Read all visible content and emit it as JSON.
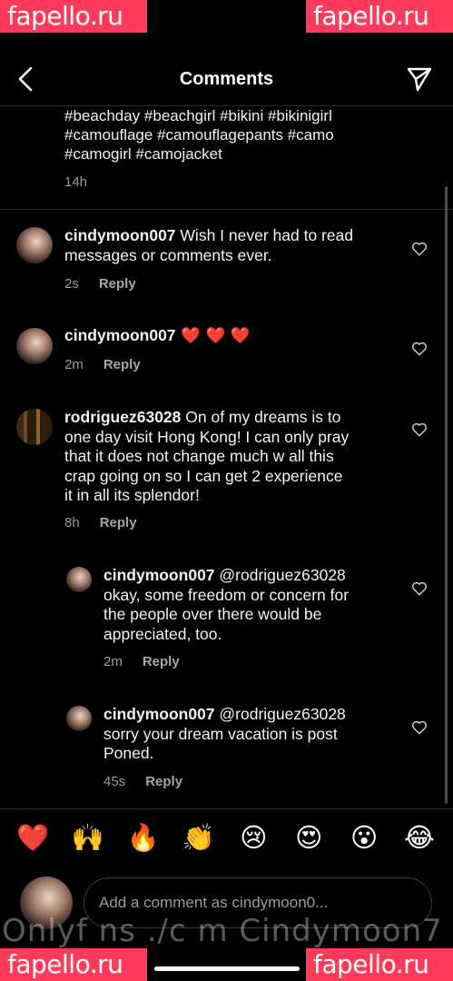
{
  "watermarks": {
    "top_left": "fapello.ru",
    "top_right": "fapello.ru",
    "bottom_left": "fapello.ru",
    "bottom_right": "fapello.ru",
    "overlay_text": "Onlyf ns ./c m Cindymoon7"
  },
  "header": {
    "title": "Comments",
    "back_icon": "chevron-left-icon",
    "send_icon": "paper-plane-icon"
  },
  "caption": {
    "lines": [
      "#beachday #beachgirl #bikini #bikinigirl",
      "#camouflage #camouflagepants #camo",
      "#camogirl #camojacket"
    ],
    "time": "14h"
  },
  "comments": [
    {
      "user": "cindymoon007",
      "lines": [
        "Wish I never had to read",
        "messages or comments ever."
      ],
      "first_line_rest": " Wish I never had to read",
      "time": "2s",
      "reply": "Reply"
    },
    {
      "user": "cindymoon007",
      "text": " ❤️ ❤️ ❤️",
      "time": "2m",
      "reply": "Reply"
    },
    {
      "user": "rodriguez63028",
      "first_line_rest": " On of my dreams is to",
      "more_lines": [
        "one day visit Hong Kong! I can only pray",
        "that it does not change much w all this",
        "crap going on so I can get 2 experience",
        "it in all its splendor!"
      ],
      "time": "8h",
      "reply": "Reply"
    },
    {
      "user": "cindymoon007",
      "first_line_rest": " @rodriguez63028",
      "more_lines": [
        "okay, some freedom or concern for",
        "the people over there would be",
        "appreciated, too."
      ],
      "time": "2m",
      "reply": "Reply"
    },
    {
      "user": "cindymoon007",
      "first_line_rest": " @rodriguez63028",
      "more_lines": [
        "sorry your dream vacation is post",
        "Poned."
      ],
      "time": "45s",
      "reply": "Reply"
    }
  ],
  "reactions": [
    "❤️",
    "🙌",
    "🔥",
    "👏",
    "😢",
    "😍",
    "😮",
    "😂"
  ],
  "composer": {
    "placeholder": "Add a comment as cindymoon0..."
  }
}
